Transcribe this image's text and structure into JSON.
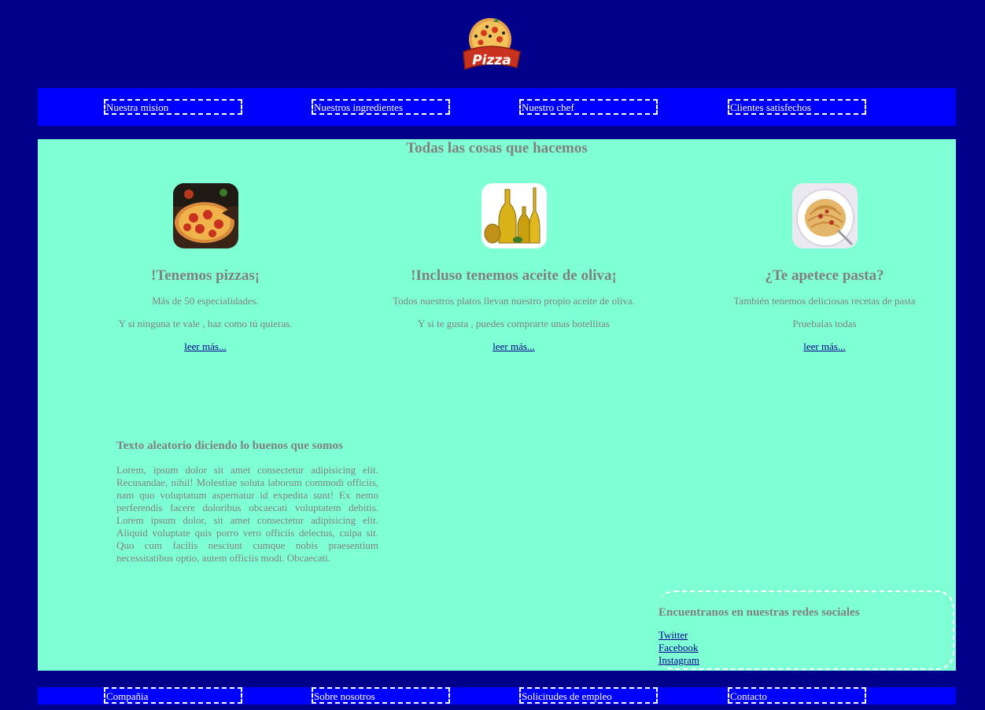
{
  "logo": {
    "text": "Pizza",
    "icon": "pizza-logo-icon"
  },
  "top_nav": {
    "items": [
      {
        "label": "Nuestra mision"
      },
      {
        "label": "Nuestros ingredientes"
      },
      {
        "label": "Nuestro chef"
      },
      {
        "label": "Clientes satisfechos"
      }
    ]
  },
  "main": {
    "title": "Todas las cosas que hacemos",
    "features": [
      {
        "image": "pizza-image",
        "heading": "!Tenemos pizzas¡",
        "line1": "Más de 50 especialidades.",
        "line2": "Y si ninguna te vale , haz como tú quieras.",
        "link": "leer más..."
      },
      {
        "image": "olive-oil-image",
        "heading": "!Incluso tenemos aceite de oliva¡",
        "line1": "Todos nuestros platos llevan nuestro propio aceite de oliva.",
        "line2": "Y si te gusta , puedes comprarte unas botellitas",
        "link": "leer más..."
      },
      {
        "image": "pasta-image",
        "heading": "¿Te apetece pasta?",
        "line1": "También tenemos deliciosas recetas de pasta",
        "line2": "Pruebalas todas",
        "link": "leer más..."
      }
    ],
    "about": {
      "heading": "Texto aleatorio diciendo lo buenos que somos",
      "body": "Lorem, ipsum dolor sit amet consectetur adipisicing elit. Recusandae, nihil! Molestiae soluta laborum commodi officiis, nam quo voluptatum aspernatur id expedita sunt! Ex nemo perferendis facere doloribus obcaecati voluptatem debitis. Lorem ipsum dolor, sit amet consectetur adipisicing elit. Aliquid voluptate quis porro vero officiis delectus, culpa sit. Quo cum facilis nesciunt cumque nobis praesentium necessitatibus optio, autem officiis modi. Obcaecati."
    },
    "social": {
      "heading": "Encuentranos en nuestras redes sociales",
      "links": [
        {
          "label": "Twitter"
        },
        {
          "label": "Facebook"
        },
        {
          "label": "Instagram"
        }
      ]
    }
  },
  "bottom_nav": {
    "items": [
      {
        "label": "Compañia"
      },
      {
        "label": "Sobre nosotros"
      },
      {
        "label": "Solicitudes de empleo"
      },
      {
        "label": "Contacto"
      }
    ]
  },
  "colors": {
    "page_bg": "#00008b",
    "nav_bg": "#0000ff",
    "main_bg": "#7fffd4",
    "text": "#808080",
    "link": "#00008b",
    "nav_text": "#ffffff"
  }
}
